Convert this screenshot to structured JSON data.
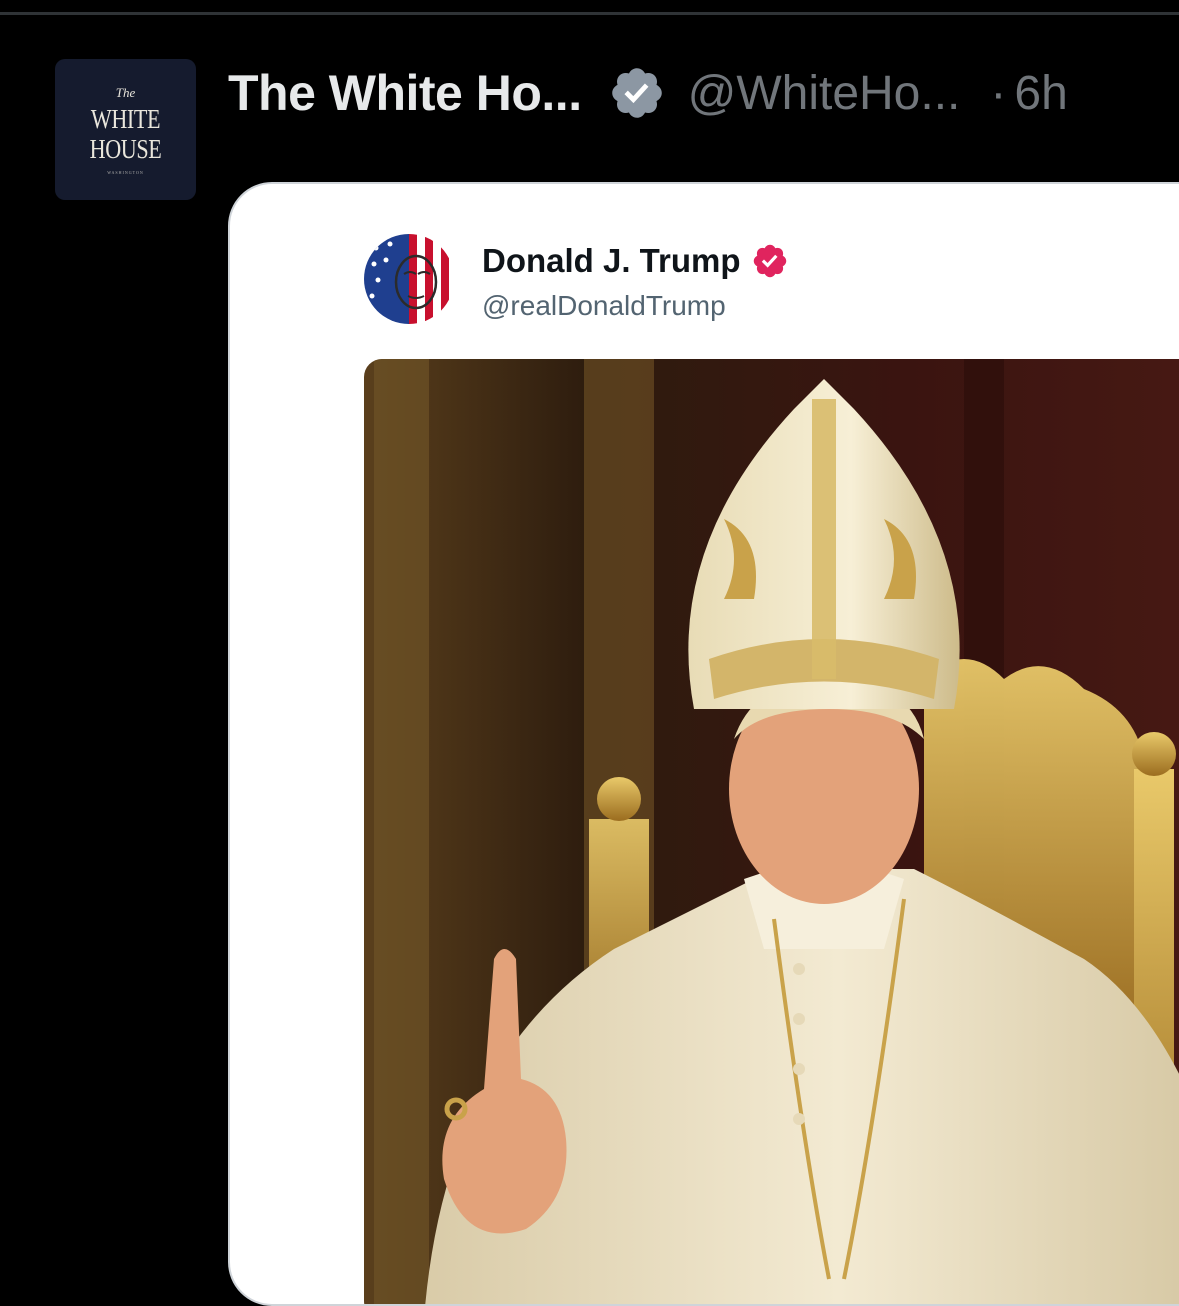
{
  "tweet": {
    "display_name": "The White Ho...",
    "handle": "@WhiteHo...",
    "separator": "·",
    "time": "6h",
    "avatar_text": {
      "the": "The",
      "line1": "WHITE",
      "line2": "HOUSE",
      "line3": "WASHINGTON"
    },
    "verified_icon": "verified-badge-icon",
    "embed": {
      "name": "Donald J. Trump",
      "handle": "@realDonaldTrump",
      "verified_icon": "verified-badge-icon",
      "image_icon": "media-image"
    }
  },
  "colors": {
    "background": "#000000",
    "text_primary": "#e7e9ea",
    "text_secondary": "#71767b",
    "verified_gray": "#8c97a3",
    "verified_pink": "#e0245e",
    "card_background": "#ffffff"
  }
}
